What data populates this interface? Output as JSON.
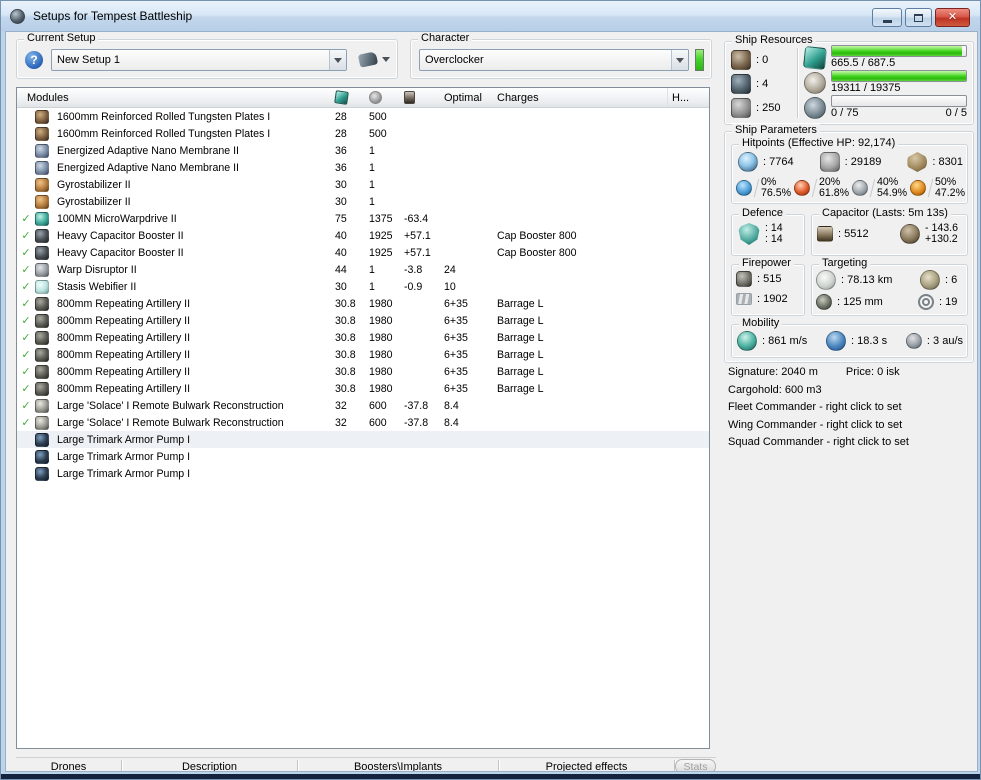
{
  "window": {
    "title": "Setups for Tempest Battleship"
  },
  "current_setup": {
    "label": "Current Setup",
    "value": "New Setup 1"
  },
  "character": {
    "label": "Character",
    "value": "Overclocker"
  },
  "modules_table": {
    "columns": {
      "modules": "Modules",
      "optimal": "Optimal",
      "charges": "Charges",
      "heat": "H..."
    },
    "column_icons": [
      "cpu-icon",
      "powergrid-icon",
      "capacitor-usage-icon"
    ],
    "rows": [
      {
        "active": false,
        "icon": "armor-plate-icon",
        "name": "1600mm Reinforced Rolled Tungsten Plates I",
        "cpu": "28",
        "pg": "500",
        "cap": "",
        "optimal": "",
        "charge": "",
        "highlight": false
      },
      {
        "active": false,
        "icon": "armor-plate-icon",
        "name": "1600mm Reinforced Rolled Tungsten Plates I",
        "cpu": "28",
        "pg": "500",
        "cap": "",
        "optimal": "",
        "charge": "",
        "highlight": false
      },
      {
        "active": false,
        "icon": "nano-membrane-icon",
        "name": "Energized Adaptive Nano Membrane II",
        "cpu": "36",
        "pg": "1",
        "cap": "",
        "optimal": "",
        "charge": "",
        "highlight": false
      },
      {
        "active": false,
        "icon": "nano-membrane-icon",
        "name": "Energized Adaptive Nano Membrane II",
        "cpu": "36",
        "pg": "1",
        "cap": "",
        "optimal": "",
        "charge": "",
        "highlight": false
      },
      {
        "active": false,
        "icon": "gyrostabilizer-icon",
        "name": "Gyrostabilizer II",
        "cpu": "30",
        "pg": "1",
        "cap": "",
        "optimal": "",
        "charge": "",
        "highlight": false
      },
      {
        "active": false,
        "icon": "gyrostabilizer-icon",
        "name": "Gyrostabilizer II",
        "cpu": "30",
        "pg": "1",
        "cap": "",
        "optimal": "",
        "charge": "",
        "highlight": false
      },
      {
        "active": true,
        "icon": "microwarpdrive-icon",
        "name": "100MN MicroWarpdrive II",
        "cpu": "75",
        "pg": "1375",
        "cap": "-63.4",
        "optimal": "",
        "charge": "",
        "highlight": false
      },
      {
        "active": true,
        "icon": "capacitor-booster-icon",
        "name": "Heavy Capacitor Booster II",
        "cpu": "40",
        "pg": "1925",
        "cap": "+57.1",
        "optimal": "",
        "charge": "Cap Booster 800",
        "highlight": false
      },
      {
        "active": true,
        "icon": "capacitor-booster-icon",
        "name": "Heavy Capacitor Booster II",
        "cpu": "40",
        "pg": "1925",
        "cap": "+57.1",
        "optimal": "",
        "charge": "Cap Booster 800",
        "highlight": false
      },
      {
        "active": true,
        "icon": "warp-disruptor-icon",
        "name": "Warp Disruptor II",
        "cpu": "44",
        "pg": "1",
        "cap": "-3.8",
        "optimal": "24",
        "charge": "",
        "highlight": false
      },
      {
        "active": true,
        "icon": "stasis-webifier-icon",
        "name": "Stasis Webifier II",
        "cpu": "30",
        "pg": "1",
        "cap": "-0.9",
        "optimal": "10",
        "charge": "",
        "highlight": false
      },
      {
        "active": true,
        "icon": "artillery-icon",
        "name": "800mm Repeating Artillery II",
        "cpu": "30.8",
        "pg": "1980",
        "cap": "",
        "optimal": "6+35",
        "charge": "Barrage L",
        "highlight": false
      },
      {
        "active": true,
        "icon": "artillery-icon",
        "name": "800mm Repeating Artillery II",
        "cpu": "30.8",
        "pg": "1980",
        "cap": "",
        "optimal": "6+35",
        "charge": "Barrage L",
        "highlight": false
      },
      {
        "active": true,
        "icon": "artillery-icon",
        "name": "800mm Repeating Artillery II",
        "cpu": "30.8",
        "pg": "1980",
        "cap": "",
        "optimal": "6+35",
        "charge": "Barrage L",
        "highlight": false
      },
      {
        "active": true,
        "icon": "artillery-icon",
        "name": "800mm Repeating Artillery II",
        "cpu": "30.8",
        "pg": "1980",
        "cap": "",
        "optimal": "6+35",
        "charge": "Barrage L",
        "highlight": false
      },
      {
        "active": true,
        "icon": "artillery-icon",
        "name": "800mm Repeating Artillery II",
        "cpu": "30.8",
        "pg": "1980",
        "cap": "",
        "optimal": "6+35",
        "charge": "Barrage L",
        "highlight": false
      },
      {
        "active": true,
        "icon": "artillery-icon",
        "name": "800mm Repeating Artillery II",
        "cpu": "30.8",
        "pg": "1980",
        "cap": "",
        "optimal": "6+35",
        "charge": "Barrage L",
        "highlight": false
      },
      {
        "active": true,
        "icon": "remote-repair-icon",
        "name": "Large 'Solace' I Remote Bulwark Reconstruction",
        "cpu": "32",
        "pg": "600",
        "cap": "-37.8",
        "optimal": "8.4",
        "charge": "",
        "highlight": false
      },
      {
        "active": true,
        "icon": "remote-repair-icon",
        "name": "Large 'Solace' I Remote Bulwark Reconstruction",
        "cpu": "32",
        "pg": "600",
        "cap": "-37.8",
        "optimal": "8.4",
        "charge": "",
        "highlight": false
      },
      {
        "active": false,
        "icon": "rig-icon",
        "name": "Large Trimark Armor Pump I",
        "cpu": "",
        "pg": "",
        "cap": "",
        "optimal": "",
        "charge": "",
        "highlight": true
      },
      {
        "active": false,
        "icon": "rig-icon",
        "name": "Large Trimark Armor Pump I",
        "cpu": "",
        "pg": "",
        "cap": "",
        "optimal": "",
        "charge": "",
        "highlight": false
      },
      {
        "active": false,
        "icon": "rig-icon",
        "name": "Large Trimark Armor Pump I",
        "cpu": "",
        "pg": "",
        "cap": "",
        "optimal": "",
        "charge": "",
        "highlight": false
      }
    ]
  },
  "ship_resources": {
    "title": "Ship Resources",
    "turret_hardpoints": ": 0",
    "launcher_hardpoints": ": 4",
    "calibration": ": 250",
    "cpu_bar": {
      "text": "665.5 / 687.5",
      "percent": 96.8
    },
    "powergrid_bar": {
      "text": "19311 / 19375",
      "percent": 99.7
    },
    "drone_bar": {
      "bandwidth_text": "0 / 75",
      "slots_text": "0 / 5",
      "percent": 0
    }
  },
  "ship_parameters": {
    "title": "Ship Parameters",
    "hitpoints": {
      "title": "Hitpoints (Effective HP: 92,174)",
      "shield_hp": ": 7764",
      "armor_hp": ": 29189",
      "hull_hp": ": 8301",
      "resists": [
        {
          "icon": "em-resist-icon",
          "shield": "0%",
          "armor": "76.5%"
        },
        {
          "icon": "thermal-resist-icon",
          "shield": "20%",
          "armor": "61.8%"
        },
        {
          "icon": "kinetic-resist-icon",
          "shield": "40%",
          "armor": "54.9%"
        },
        {
          "icon": "explosive-resist-icon",
          "shield": "50%",
          "armor": "47.2%"
        }
      ]
    },
    "defence": {
      "title": "Defence",
      "value_top": ": 14",
      "value_bottom": ": 14"
    },
    "capacitor": {
      "title": "Capacitor (Lasts: 5m 13s)",
      "amount": ": 5512",
      "drain": "- 143.6",
      "recharge": "+130.2"
    },
    "firepower": {
      "title": "Firepower",
      "volley": ": 515",
      "dps": ": 1902"
    },
    "targeting": {
      "title": "Targeting",
      "range": ": 78.13 km",
      "max_targets": ": 6",
      "sig_resolution": ": 125 mm",
      "scan_resolution": ": 19"
    },
    "mobility": {
      "title": "Mobility",
      "speed": ": 861 m/s",
      "align_time": ": 18.3 s",
      "warp_speed": ": 3 au/s"
    }
  },
  "info": {
    "signature": "Signature: 2040 m",
    "price": "Price: 0 isk",
    "cargohold": "Cargohold: 600 m3",
    "fleet_commander": "Fleet Commander - right click to set",
    "wing_commander": "Wing Commander - right click to set",
    "squad_commander": "Squad Commander - right click to set"
  },
  "bottom_tabs": [
    {
      "label": "Drones"
    },
    {
      "label": "Description"
    },
    {
      "label": "Boosters\\Implants"
    },
    {
      "label": "Projected effects"
    }
  ],
  "stats_button_label": "Stats",
  "colors": {
    "progress_green": "#39cf16",
    "character_status_green": "#45d42a",
    "active_check_green": "#43aa3c",
    "close_button_red": "#bf3425",
    "titlebar_blue": "#c2d7ec"
  }
}
